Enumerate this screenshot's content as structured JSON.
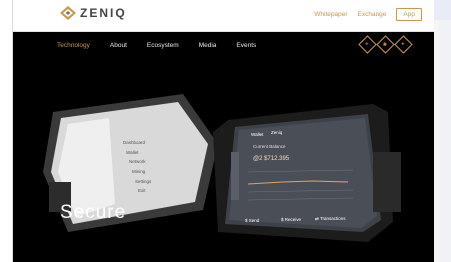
{
  "brand": {
    "name": "ZENIQ"
  },
  "header": {
    "links": [
      "Whitepaper",
      "Exchange"
    ],
    "app_button": "App"
  },
  "nav": {
    "items": [
      "Technology",
      "About",
      "Ecosystem",
      "Media",
      "Events"
    ]
  },
  "social_icons": [
    "social-icon-1",
    "social-icon-2",
    "social-icon-3"
  ],
  "hero": {
    "caption": "Secure"
  },
  "left_tablet": {
    "menu": [
      "Dashboard",
      "Wallet",
      "Network",
      "Mining",
      "Settings",
      "Exit"
    ]
  },
  "right_tablet": {
    "tabs": [
      "Wallet",
      "Zeniq"
    ],
    "balance_label": "Current Balance",
    "balance_value": "@2 $712.395",
    "buttons": [
      "$ Send",
      "$ Receive",
      "⇄ Transactions"
    ]
  },
  "colors": {
    "accent": "#c8974a",
    "hero_bg": "#000000"
  }
}
